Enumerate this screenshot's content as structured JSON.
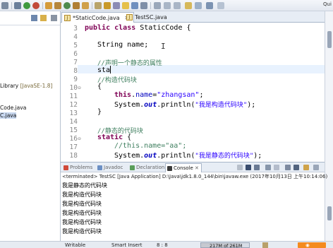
{
  "window": {
    "quick_access": "Qui"
  },
  "package_explorer": {
    "items": [
      {
        "label": "Library",
        "suffix": "[JavaSE-1.8]"
      },
      {
        "label": "Code.java"
      },
      {
        "label": "C.java"
      }
    ]
  },
  "editor": {
    "tabs": [
      {
        "label": "*StaticCode.java",
        "active": true
      },
      {
        "label": "TestSC.java",
        "active": false
      }
    ],
    "lines": [
      {
        "num": "3",
        "fold": ""
      },
      {
        "num": "4",
        "fold": ""
      },
      {
        "num": "5",
        "fold": ""
      },
      {
        "num": "6",
        "fold": ""
      },
      {
        "num": "7",
        "fold": ""
      },
      {
        "num": "8",
        "fold": ""
      },
      {
        "num": "9",
        "fold": ""
      },
      {
        "num": "10",
        "fold": "⊖"
      },
      {
        "num": "11",
        "fold": ""
      },
      {
        "num": "12",
        "fold": ""
      },
      {
        "num": "13",
        "fold": ""
      },
      {
        "num": "14",
        "fold": ""
      },
      {
        "num": "15",
        "fold": ""
      },
      {
        "num": "16",
        "fold": "⊖"
      },
      {
        "num": "17",
        "fold": ""
      },
      {
        "num": "18",
        "fold": ""
      }
    ],
    "code": {
      "l3_kw": "public class",
      "l3_rest": " StaticCode {",
      "l5": "String name;",
      "l7": "//声明一个静态的属性",
      "l8": "sta",
      "l9": "//构造代码块",
      "l10": "{",
      "l11_kw": "this",
      "l11_field": "name",
      "l11_str": "\"zhangsan\"",
      "l12_pre": "System.",
      "l12_out": "out",
      "l12_mid": ".println(",
      "l12_str": "\"我是构造代码块\"",
      "l12_end": ");",
      "l13": "}",
      "l15": "//静态的代码块",
      "l16_kw": "static",
      "l16_rest": " {",
      "l17": "//this.name=\"aa\";",
      "l18_pre": "System.",
      "l18_out": "out",
      "l18_mid": ".println(",
      "l18_str": "\"我是静态的代码块\"",
      "l18_end": ");"
    }
  },
  "console": {
    "tabs": [
      {
        "label": "Problems",
        "color": "#d04a3a"
      },
      {
        "label": "Javadoc",
        "color": "#6b8fc4"
      },
      {
        "label": "Declaration",
        "color": "#5a9e5a"
      },
      {
        "label": "Console",
        "color": "#3a3a3a",
        "active": true
      }
    ],
    "terminated": "<terminated> TestSC [Java Application] D:\\Java\\jdk1.8.0_144\\bin\\javaw.exe (2017年10月13日 上午10:14:06)",
    "output": [
      "我是静态的代码块",
      "我是构造代码块",
      "我是构造代码块",
      "我是构造代码块",
      "我是构造代码块",
      "我是构造代码块"
    ]
  },
  "status_bar": {
    "mode": "Writable",
    "insert": "Smart Insert",
    "position": "8 : 8",
    "heap": "217M of 261M",
    "heap_fraction": 0.83
  }
}
